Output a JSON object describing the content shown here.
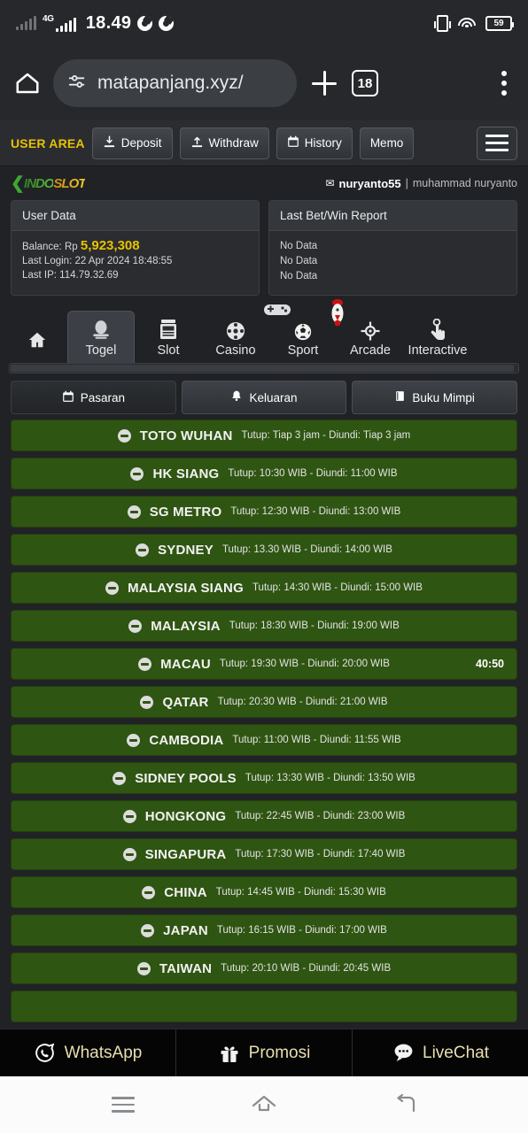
{
  "status_bar": {
    "network_label": "4G",
    "time": "18.49",
    "battery": "59",
    "icons": [
      "signal-weak-icon",
      "signal-4g-icon",
      "chrome-icon",
      "chrome-icon",
      "vibrate-icon",
      "wifi-icon",
      "battery-icon"
    ]
  },
  "browser": {
    "home_icon": "home-icon",
    "site_settings_icon": "tune-icon",
    "url": "matapanjang.xyz/",
    "new_tab_label": "+",
    "tab_count": "18",
    "menu_icon": "kebab-menu-icon"
  },
  "user_area": {
    "title": "USER AREA",
    "buttons": [
      {
        "label": "Deposit",
        "icon": "deposit-icon"
      },
      {
        "label": "Withdraw",
        "icon": "withdraw-icon"
      },
      {
        "label": "History",
        "icon": "calendar-icon"
      },
      {
        "label": "Memo",
        "icon": ""
      }
    ],
    "menu_icon": "hamburger-icon"
  },
  "brand": {
    "chevron": "❮",
    "name_part1": "INDO",
    "name_part2": "SLOT"
  },
  "account": {
    "mail_icon": "envelope-icon",
    "username": "nuryanto55",
    "separator": "|",
    "fullname": "muhammad nuryanto"
  },
  "panels": {
    "user_data": {
      "header": "User Data",
      "balance_label": "Balance: Rp",
      "balance_value": "5,923,308",
      "last_login": "Last Login: 22 Apr 2024 18:48:55",
      "last_ip": "Last IP: 114.79.32.69"
    },
    "last_bet": {
      "header": "Last Bet/Win Report",
      "rows": [
        "No Data",
        "No Data",
        "No Data"
      ]
    }
  },
  "nav_tabs": [
    {
      "label": "",
      "icon": "home-icon",
      "active": false,
      "name": "home"
    },
    {
      "label": "Togel",
      "icon": "togel-icon",
      "active": true,
      "name": "togel"
    },
    {
      "label": "Slot",
      "icon": "slot-machine-icon",
      "active": false,
      "name": "slot"
    },
    {
      "label": "Casino",
      "icon": "casino-chip-icon",
      "active": false,
      "name": "casino"
    },
    {
      "label": "Sport",
      "icon": "soccer-ball-icon",
      "active": false,
      "name": "sport"
    },
    {
      "label": "Arcade",
      "icon": "target-icon",
      "active": false,
      "name": "arcade"
    },
    {
      "label": "Interactive",
      "icon": "tap-hand-icon",
      "active": false,
      "name": "interactive"
    }
  ],
  "floating_icons": [
    "gamepad-icon",
    "rooster-icon"
  ],
  "sub_tabs": [
    {
      "label": "Pasaran",
      "icon": "calendar-icon",
      "active": true
    },
    {
      "label": "Keluaran",
      "icon": "bell-icon",
      "active": false
    },
    {
      "label": "Buku Mimpi",
      "icon": "book-icon",
      "active": false
    }
  ],
  "markets": [
    {
      "name": "TOTO WUHAN",
      "schedule": "Tutup: Tiap 3 jam - Diundi: Tiap 3 jam",
      "countdown": ""
    },
    {
      "name": "HK SIANG",
      "schedule": "Tutup: 10:30 WIB - Diundi: 11:00 WIB",
      "countdown": ""
    },
    {
      "name": "SG METRO",
      "schedule": "Tutup: 12:30 WIB - Diundi: 13:00 WIB",
      "countdown": ""
    },
    {
      "name": "SYDNEY",
      "schedule": "Tutup: 13.30 WIB - Diundi: 14:00 WIB",
      "countdown": ""
    },
    {
      "name": "MALAYSIA SIANG",
      "schedule": "Tutup: 14:30 WIB - Diundi: 15:00 WIB",
      "countdown": ""
    },
    {
      "name": "MALAYSIA",
      "schedule": "Tutup: 18:30 WIB - Diundi: 19:00 WIB",
      "countdown": ""
    },
    {
      "name": "MACAU",
      "schedule": "Tutup: 19:30 WIB - Diundi: 20:00 WIB",
      "countdown": "40:50"
    },
    {
      "name": "QATAR",
      "schedule": "Tutup: 20:30 WIB - Diundi: 21:00 WIB",
      "countdown": ""
    },
    {
      "name": "CAMBODIA",
      "schedule": "Tutup: 11:00 WIB - Diundi: 11:55 WIB",
      "countdown": ""
    },
    {
      "name": "SIDNEY POOLS",
      "schedule": "Tutup: 13:30 WIB - Diundi: 13:50 WIB",
      "countdown": ""
    },
    {
      "name": "HONGKONG",
      "schedule": "Tutup: 22:45 WIB - Diundi: 23:00 WIB",
      "countdown": ""
    },
    {
      "name": "SINGAPURA",
      "schedule": "Tutup: 17:30 WIB - Diundi: 17:40 WIB",
      "countdown": ""
    },
    {
      "name": "CHINA",
      "schedule": "Tutup: 14:45 WIB - Diundi: 15:30 WIB",
      "countdown": ""
    },
    {
      "name": "JAPAN",
      "schedule": "Tutup: 16:15 WIB - Diundi: 17:00 WIB",
      "countdown": ""
    },
    {
      "name": "TAIWAN",
      "schedule": "Tutup: 20:10 WIB - Diundi: 20:45 WIB",
      "countdown": ""
    },
    {
      "name": "",
      "schedule": "",
      "countdown": ""
    }
  ],
  "bottom_bar": [
    {
      "label": "WhatsApp",
      "icon": "whatsapp-icon"
    },
    {
      "label": "Promosi",
      "icon": "gift-icon"
    },
    {
      "label": "LiveChat",
      "icon": "chat-bubble-icon"
    }
  ],
  "android_nav": [
    {
      "icon": "recents-icon"
    },
    {
      "icon": "home-icon"
    },
    {
      "icon": "back-icon"
    }
  ],
  "colors": {
    "accent_yellow": "#e8c200",
    "market_green": "#2f5512",
    "page_bg": "#202226",
    "bottom_text": "#e8dfb0"
  }
}
